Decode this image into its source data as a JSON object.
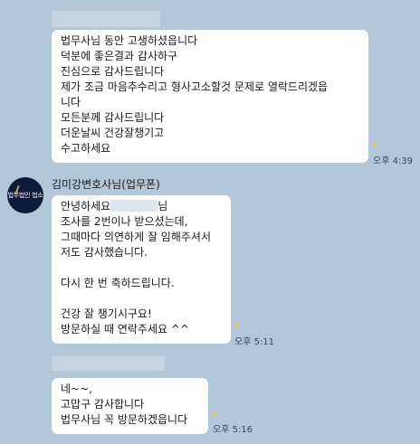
{
  "messages": [
    {
      "side": "outgoing",
      "lines": [
        "법무사님  동안 고생하셨읍니다",
        "덕분에 좋은결과 감사하구",
        "진심으로 감사드립니다",
        "제가 조금 마음추수리고  형사고소할것 문제로 열락드리겠읍",
        "니다",
        "모든분께  감사드립니다",
        "더운날씨 건강잘챙기고",
        "수고하세요"
      ],
      "time": "오후 4:39"
    },
    {
      "side": "incoming",
      "sender": "김미강변호사님(업무폰)",
      "line1_before_mask": "안녕하세요",
      "line1_after_mask": "님",
      "lines": [
        "조사를 2번이나 받으셨는데,",
        "그때마다 의연하게 잘 임해주셔서",
        "저도 감사했습니다.",
        "",
        "다시 한 번 축하드립니다.",
        "",
        "건강 잘 챙기시구요!",
        "방문하실 때 연락주세요 ^^"
      ],
      "time": "오후 5:11"
    },
    {
      "side": "outgoing",
      "lines": [
        "네~~,",
        "고맙구  감사합니다",
        "법무사님  꼭 방문하겠읍니다"
      ],
      "time": "오후 5:16"
    }
  ],
  "avatar": {
    "icon": "law-firm-logo-icon",
    "logo_text": "법무법인 법소"
  },
  "colors": {
    "background": "#b2c7da",
    "bubble": "#ffffff",
    "read_dot": "#f2c94c",
    "avatar_bg": "#0d1b3a"
  }
}
